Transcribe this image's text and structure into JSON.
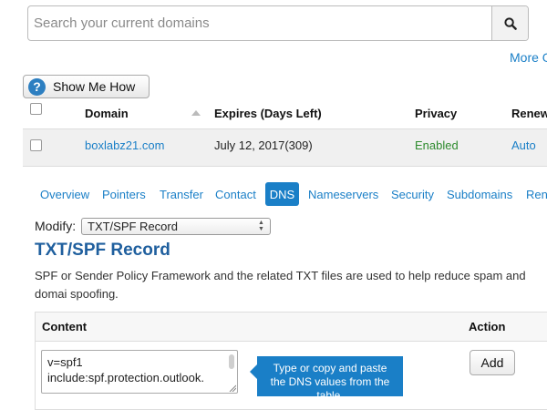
{
  "search": {
    "placeholder": "Search your current domains"
  },
  "more_link": "More O",
  "show_me_how": "Show Me How",
  "table": {
    "headers": {
      "domain": "Domain",
      "expires": "Expires (Days Left)",
      "privacy": "Privacy",
      "renew": "Renew"
    },
    "row": {
      "domain": "boxlabz21.com",
      "expires": "July 12, 2017(309)",
      "privacy": "Enabled",
      "renew": "Auto"
    }
  },
  "tabs": [
    "Overview",
    "Pointers",
    "Transfer",
    "Contact",
    "DNS",
    "Nameservers",
    "Security",
    "Subdomains",
    "Ren"
  ],
  "active_tab": "DNS",
  "modify": {
    "label": "Modify:",
    "selected": "TXT/SPF Record"
  },
  "record": {
    "title": "TXT/SPF Record",
    "description": "SPF or Sender Policy Framework and the related TXT files are used to help reduce spam and domai spoofing."
  },
  "content_table": {
    "content_header": "Content",
    "action_header": "Action",
    "value_line1": "v=spf1",
    "value_line2": "include:spf.protection.outlook.",
    "add_label": "Add"
  },
  "tooltip": "Type or copy and paste the DNS values from the table.",
  "colors": {
    "link": "#1a7fc7",
    "title": "#1f5f9e",
    "enabled": "#2e8b2e",
    "tooltip_bg": "#1a7fc7"
  }
}
